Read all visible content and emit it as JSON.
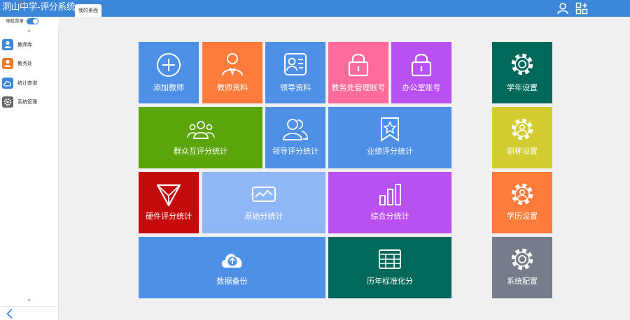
{
  "app": {
    "title": "洞山中学-评分系统",
    "tab": "我的桌面"
  },
  "header": {
    "user_icon": "user-icon",
    "apps_icon": "apps-add-icon"
  },
  "nav": {
    "label": "导航菜单",
    "toggle_on": true
  },
  "sidebar": {
    "items": [
      {
        "label": "教师库",
        "icon": "user-icon",
        "color": "#3b86d8"
      },
      {
        "label": "教务处",
        "icon": "user-icon",
        "color": "#f07a2e"
      },
      {
        "label": "统计查询",
        "icon": "cloud-icon",
        "color": "#3b86d8"
      },
      {
        "label": "系统管理",
        "icon": "gear-icon",
        "color": "#666666"
      }
    ]
  },
  "tiles": {
    "add_teacher": {
      "label": "添加教师",
      "icon": "plus-circle-icon",
      "color": "#4d90e6"
    },
    "teacher_info": {
      "label": "教师资料",
      "icon": "teacher-icon",
      "color": "#fd7c3b"
    },
    "leader_info": {
      "label": "领导资料",
      "icon": "profile-card-icon",
      "color": "#4d90e6"
    },
    "academic_account": {
      "label": "教务处管理账号",
      "icon": "lock-icon",
      "color": "#ff6b9a"
    },
    "office_account": {
      "label": "办公室账号",
      "icon": "lock-icon",
      "color": "#b851f0"
    },
    "school_year": {
      "label": "学年设置",
      "icon": "gear-icon",
      "color": "#00695c"
    },
    "mass_eval": {
      "label": "群众互评分统计",
      "icon": "group-icon",
      "color": "#5ba50b"
    },
    "leader_eval": {
      "label": "领导评分统计",
      "icon": "users-icon",
      "color": "#4d90e6"
    },
    "performance_eval": {
      "label": "业绩评分统计",
      "icon": "bookmark-star-icon",
      "color": "#4d90e6"
    },
    "title_setting": {
      "label": "职称设置",
      "icon": "gear-user-icon",
      "color": "#d3cc30"
    },
    "hardware_eval": {
      "label": "硬件评分统计",
      "icon": "triangle-icon",
      "color": "#c40a0a"
    },
    "raw_stats": {
      "label": "原始分统计",
      "icon": "monitor-chart-icon",
      "color": "#8fb7f7"
    },
    "composite_stats": {
      "label": "综合分统计",
      "icon": "bar-chart-icon",
      "color": "#b851f0"
    },
    "education_setting": {
      "label": "学历设置",
      "icon": "gear-user-icon",
      "color": "#fd7c3b"
    },
    "backup": {
      "label": "数据备份",
      "icon": "cloud-upload-icon",
      "color": "#4d90e6"
    },
    "standardize": {
      "label": "历年标准化分",
      "icon": "table-icon",
      "color": "#00695c"
    },
    "system_config": {
      "label": "系统配置",
      "icon": "gear-icon",
      "color": "#757d8a"
    }
  }
}
